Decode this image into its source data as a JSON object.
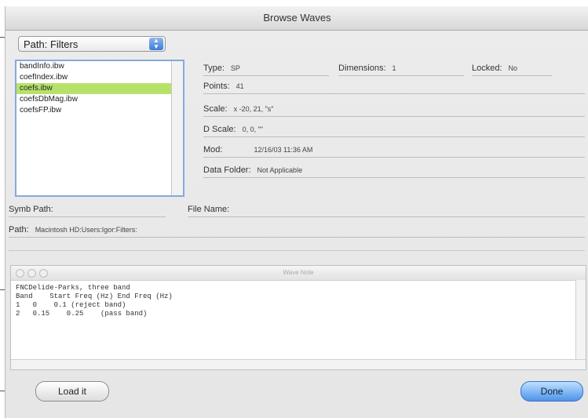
{
  "window": {
    "title": "Browse Waves"
  },
  "path_popup": {
    "label": "Path: Filters"
  },
  "wave_list": {
    "items": [
      {
        "label": "bandInfo.ibw",
        "selected": false
      },
      {
        "label": "coefIndex.ibw",
        "selected": false
      },
      {
        "label": "coefs.ibw",
        "selected": true
      },
      {
        "label": "coefsDbMag.ibw",
        "selected": false
      },
      {
        "label": "coefsFP.ibw",
        "selected": false
      }
    ]
  },
  "info": {
    "type_label": "Type:",
    "type_value": "SP",
    "dimensions_label": "Dimensions:",
    "dimensions_value": "1",
    "locked_label": "Locked:",
    "locked_value": "No",
    "points_label": "Points:",
    "points_value": "41",
    "scale_label": "Scale:",
    "scale_value": "x -20, 21, \"s\"",
    "dscale_label": "D Scale:",
    "dscale_value": "0, 0, \"\"",
    "mod_label": "Mod:",
    "mod_value": "12/16/03 11:36 AM",
    "datafolder_label": "Data Folder:",
    "datafolder_value": "Not Applicable"
  },
  "symb_path_label": "Symb Path:",
  "file_name_label": "File Name:",
  "path_label": "Path:",
  "path_value": "Macintosh HD:Users:Igor:Filters:",
  "wave_note": {
    "title": "Wave Note",
    "lines": [
      "FNCDelide-Parks, three band",
      "Band    Start Freq (Hz) End Freq (Hz)",
      "1   0    0.1 (reject band)",
      "2   0.15    0.25    (pass band)"
    ]
  },
  "buttons": {
    "load": "Load it",
    "done": "Done"
  },
  "colors": {
    "selection": "#b6e26a",
    "default_button": "#4d93ea",
    "focus_ring": "#86a9db"
  }
}
